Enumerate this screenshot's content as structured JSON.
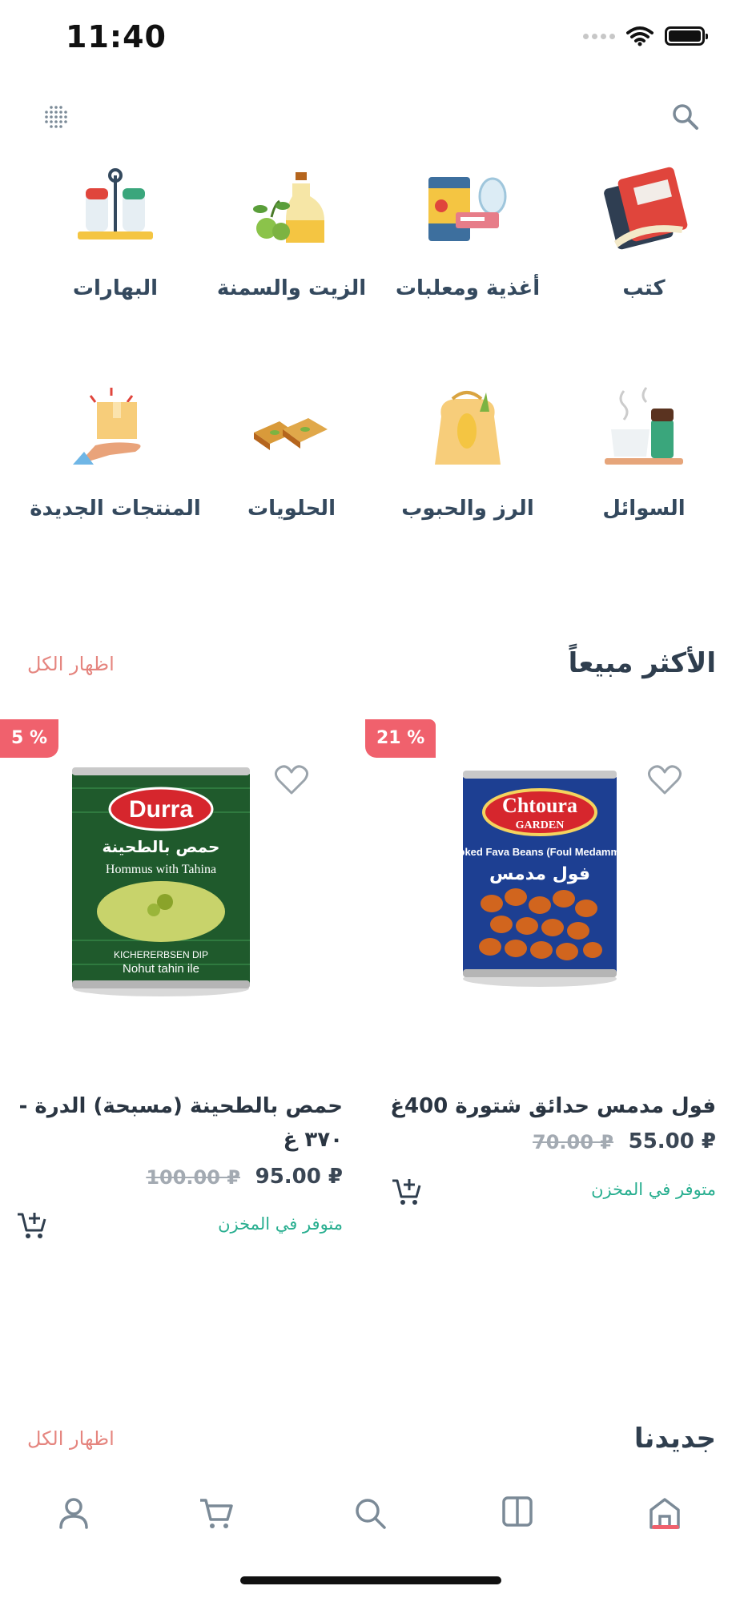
{
  "status_bar": {
    "time": "11:40"
  },
  "categories": [
    {
      "label": "كتب",
      "icon": "book-icon"
    },
    {
      "label": "أغذية ومعلبات",
      "icon": "canned-food-icon"
    },
    {
      "label": "الزيت والسمنة",
      "icon": "oil-bottle-icon"
    },
    {
      "label": "البهارات",
      "icon": "spice-shakers-icon"
    },
    {
      "label": "السوائل",
      "icon": "coffee-cup-icon"
    },
    {
      "label": "الرز والحبوب",
      "icon": "grain-sack-icon"
    },
    {
      "label": "الحلويات",
      "icon": "baklava-icon"
    },
    {
      "label": "المنتجات الجديدة",
      "icon": "new-product-icon"
    }
  ],
  "best_sellers": {
    "title": "الأكثر مبيعاً",
    "show_all": "اظهار الكل",
    "products": [
      {
        "badge": "% 21",
        "name": "فول مدمس حدائق شتورة 400غ",
        "price": "55.00 ₽",
        "old_price": "70.00 ₽",
        "stock": "متوفر في المخزن",
        "image_brand": "Chtoura GARDEN",
        "image_text": "Cooked Fava Beans (Foul Medammas)",
        "image_arabic": "فول مدمس"
      },
      {
        "badge": "% 5",
        "name": "حمص بالطحينة (مسبحة) الدرة - ٣٧٠ غ",
        "price": "95.00 ₽",
        "old_price": "100.00 ₽",
        "stock": "متوفر في المخزن",
        "image_brand": "Durra",
        "image_text": "Hommus with Tahina",
        "image_arabic": "حمص بالطحينة"
      }
    ]
  },
  "new_arrivals": {
    "title": "جديدنا",
    "show_all": "اظهار الكل"
  },
  "nav": [
    {
      "name": "profile",
      "icon": "user-icon"
    },
    {
      "name": "cart",
      "icon": "cart-icon"
    },
    {
      "name": "search",
      "icon": "search-icon"
    },
    {
      "name": "catalog",
      "icon": "book-open-icon"
    },
    {
      "name": "home",
      "icon": "home-icon",
      "active": true
    }
  ],
  "colors": {
    "accent": "#f0616d",
    "stock": "#27ae8f",
    "show_all": "#e5857f"
  }
}
